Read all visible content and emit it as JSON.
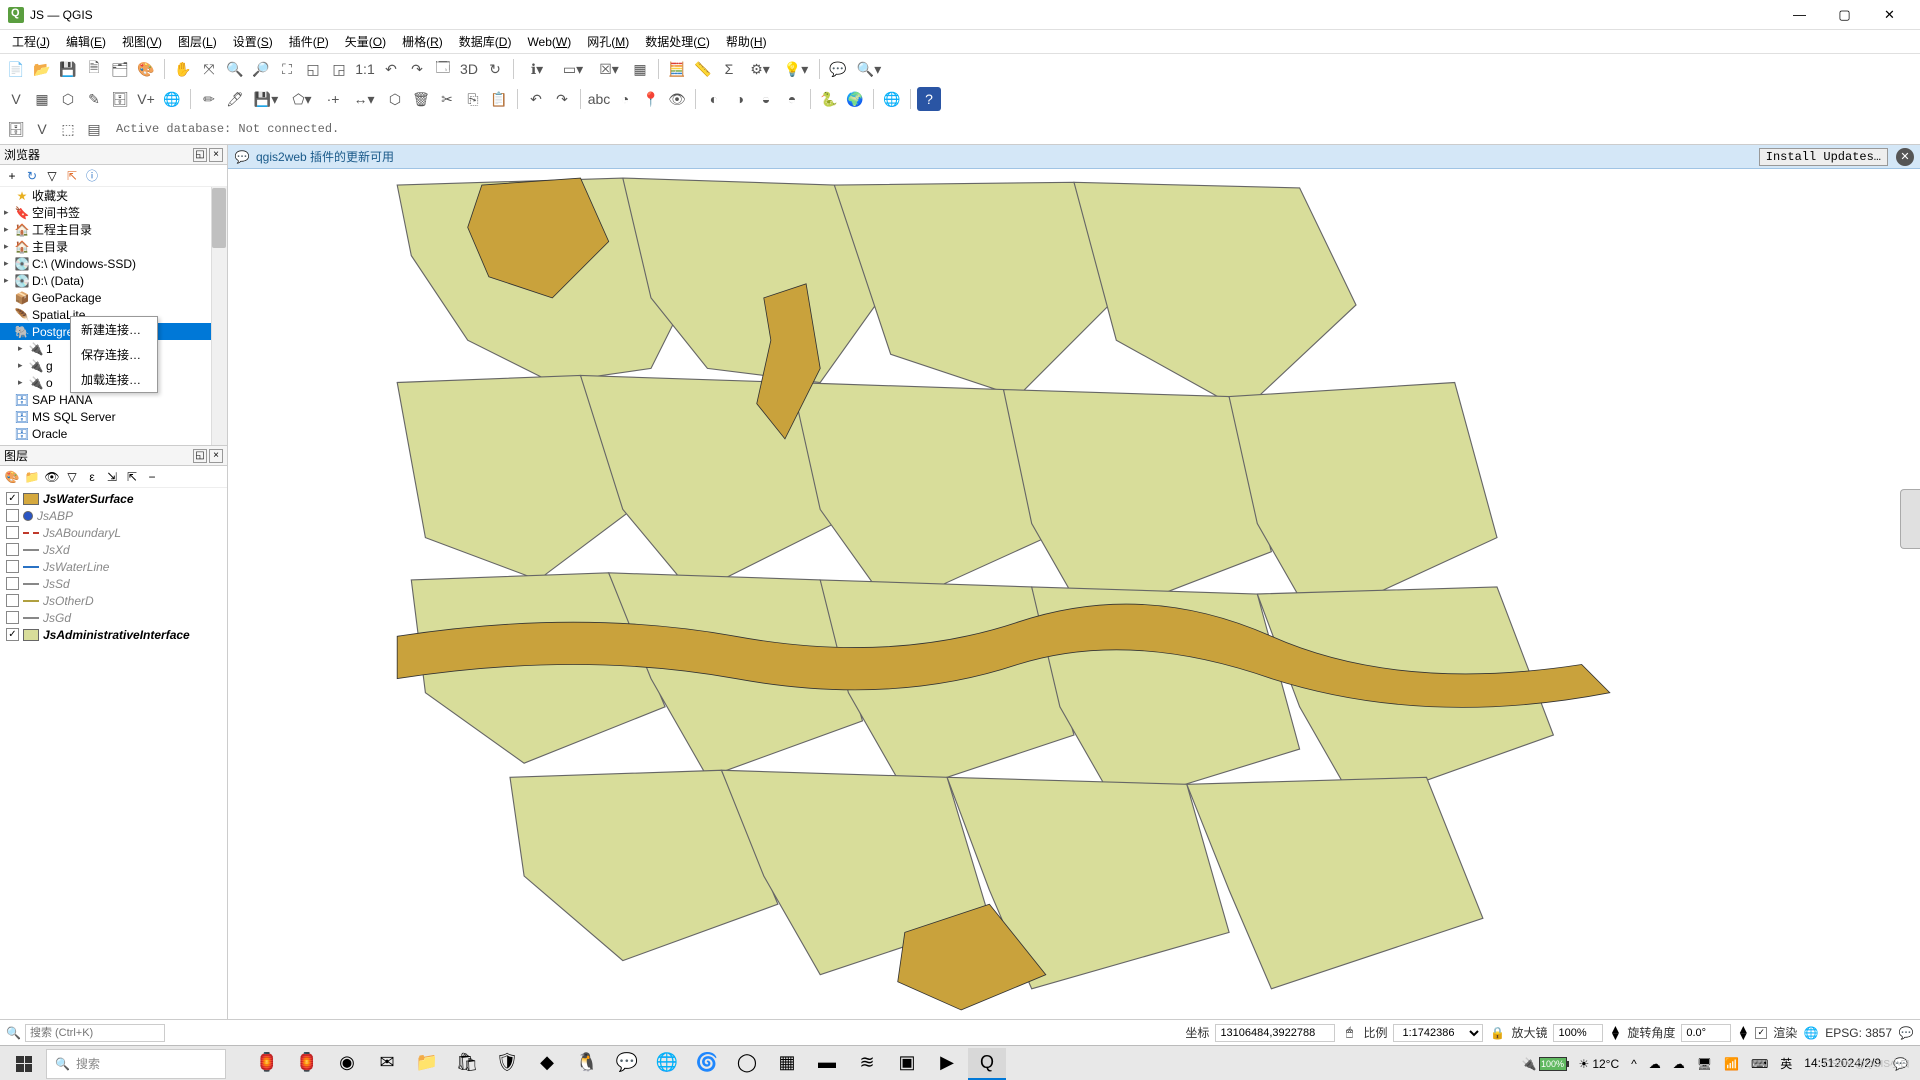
{
  "window": {
    "title": "JS — QGIS"
  },
  "menus": [
    {
      "label": "工程",
      "key": "J"
    },
    {
      "label": "编辑",
      "key": "E"
    },
    {
      "label": "视图",
      "key": "V"
    },
    {
      "label": "图层",
      "key": "L"
    },
    {
      "label": "设置",
      "key": "S"
    },
    {
      "label": "插件",
      "key": "P"
    },
    {
      "label": "矢量",
      "key": "O"
    },
    {
      "label": "栅格",
      "key": "R"
    },
    {
      "label": "数据库",
      "key": "D"
    },
    {
      "label": "Web",
      "key": "W"
    },
    {
      "label": "网孔",
      "key": "M"
    },
    {
      "label": "数据处理",
      "key": "C"
    },
    {
      "label": "帮助",
      "key": "H"
    }
  ],
  "db_status": "Active database: Not connected.",
  "browser": {
    "title": "浏览器",
    "items": [
      {
        "label": "收藏夹",
        "icon": "star",
        "color": "c-yellow"
      },
      {
        "label": "空间书签",
        "icon": "bookmark",
        "color": "c-blue",
        "expand": "▸"
      },
      {
        "label": "工程主目录",
        "icon": "home",
        "color": "c-green",
        "expand": "▸"
      },
      {
        "label": "主目录",
        "icon": "home",
        "color": "c-gray",
        "expand": "▸"
      },
      {
        "label": "C:\\ (Windows-SSD)",
        "icon": "drive",
        "color": "c-gray",
        "expand": "▸"
      },
      {
        "label": "D:\\ (Data)",
        "icon": "drive",
        "color": "c-gray",
        "expand": "▸"
      },
      {
        "label": "GeoPackage",
        "icon": "box",
        "color": "c-orange"
      },
      {
        "label": "SpatiaLite",
        "icon": "feather",
        "color": "c-blue"
      },
      {
        "label": "PostgreSQL",
        "icon": "elephant",
        "color": "c-blue",
        "selected": true
      },
      {
        "label": "1",
        "icon": "conn",
        "color": "c-orange",
        "expand": "▸",
        "indent": 1
      },
      {
        "label": "g",
        "icon": "conn",
        "color": "c-orange",
        "expand": "▸",
        "indent": 1
      },
      {
        "label": "o",
        "icon": "conn",
        "color": "c-orange",
        "expand": "▸",
        "indent": 1
      },
      {
        "label": "SAP HANA",
        "icon": "db",
        "color": "c-blue"
      },
      {
        "label": "MS SQL Server",
        "icon": "db",
        "color": "c-blue"
      },
      {
        "label": "Oracle",
        "icon": "db",
        "color": "c-blue"
      }
    ],
    "context_menu": [
      "新建连接…",
      "保存连接…",
      "加载连接…"
    ]
  },
  "layers_panel": {
    "title": "图层",
    "items": [
      {
        "name": "JsWaterSurface",
        "checked": true,
        "sym": "#d5a93f"
      },
      {
        "name": "JsABP",
        "checked": false,
        "sym": "#2a55c4",
        "shape": "circle"
      },
      {
        "name": "JsABoundaryL",
        "checked": false,
        "sym": "#c0392b",
        "shape": "dash"
      },
      {
        "name": "JsXd",
        "checked": false,
        "sym": "#888",
        "shape": "line"
      },
      {
        "name": "JsWaterLine",
        "checked": false,
        "sym": "#2a72c4",
        "shape": "line"
      },
      {
        "name": "JsSd",
        "checked": false,
        "sym": "#888",
        "shape": "line"
      },
      {
        "name": "JsOtherD",
        "checked": false,
        "sym": "#b0a040",
        "shape": "line"
      },
      {
        "name": "JsGd",
        "checked": false,
        "sym": "#888",
        "shape": "line"
      },
      {
        "name": "JsAdministrativeInterface",
        "checked": true,
        "sym": "#d8dd9a"
      }
    ]
  },
  "notification": {
    "text": "qgis2web 插件的更新可用",
    "button": "Install Updates…"
  },
  "locator": {
    "placeholder": "搜索 (Ctrl+K)"
  },
  "status": {
    "coord_label": "坐标",
    "coord_value": "13106484,3922788",
    "scale_label": "比例",
    "scale_value": "1:1742386",
    "magnifier_label": "放大镜",
    "magnifier_value": "100%",
    "rotation_label": "旋转角度",
    "rotation_value": "0.0°",
    "render_label": "渲染",
    "crs_label": "EPSG: 3857"
  },
  "taskbar": {
    "search_placeholder": "搜索",
    "battery": "100%",
    "weather": "12°C",
    "ime": "英",
    "time": "14:51",
    "date": "2024/2/9",
    "watermark": "CSDN @QGIS小白"
  }
}
